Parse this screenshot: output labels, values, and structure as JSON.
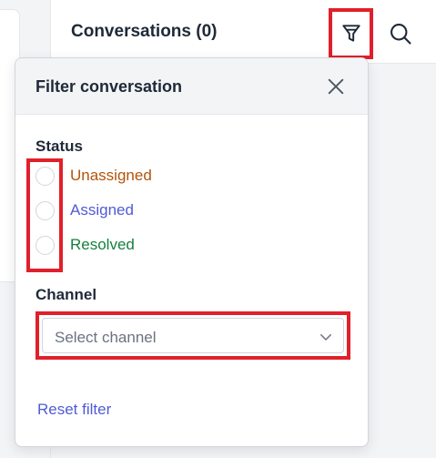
{
  "header": {
    "title": "Conversations (0)",
    "filter_icon": "filter-icon",
    "search_icon": "search-icon"
  },
  "filter_popup": {
    "title": "Filter conversation",
    "close_icon": "close-icon",
    "status": {
      "label": "Status",
      "options": [
        {
          "label": "Unassigned",
          "color": "#b45309",
          "checked": false
        },
        {
          "label": "Assigned",
          "color": "#4f5bd5",
          "checked": false
        },
        {
          "label": "Resolved",
          "color": "#15803d",
          "checked": false
        }
      ]
    },
    "channel": {
      "label": "Channel",
      "placeholder": "Select channel",
      "chevron_icon": "chevron-down-icon"
    },
    "reset_label": "Reset filter"
  },
  "colors": {
    "highlight": "#e0202a",
    "link": "#4f5bd5",
    "panel_bg": "#f3f4f6"
  }
}
